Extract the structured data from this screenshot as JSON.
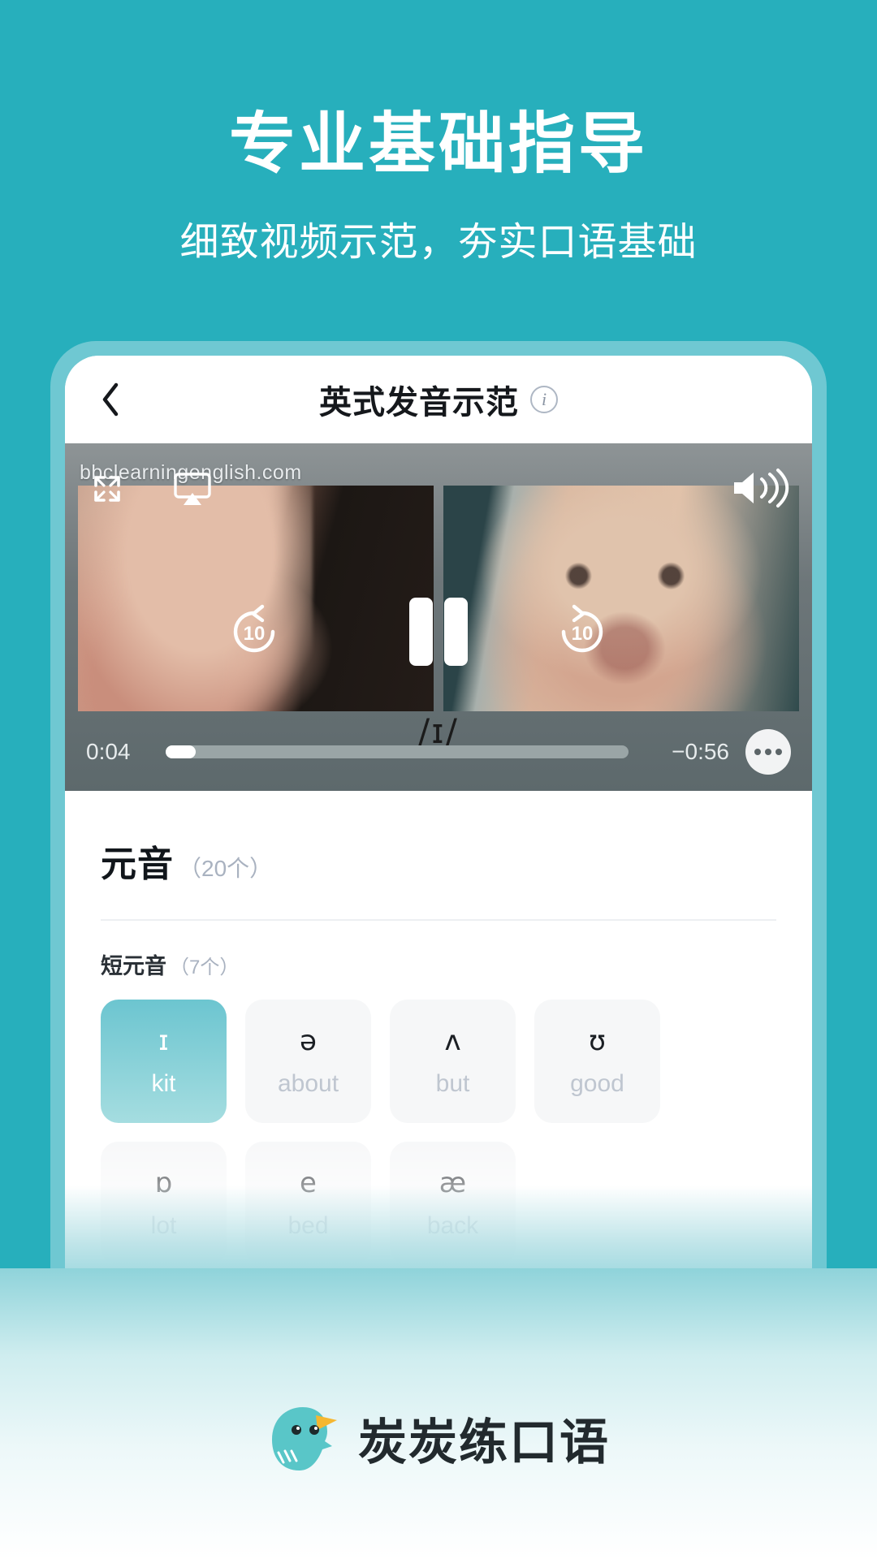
{
  "hero": {
    "title": "专业基础指导",
    "subtitle": "细致视频示范，夯实口语基础"
  },
  "phone": {
    "navbar": {
      "back_icon": "chevron-left-icon",
      "title": "英式发音示范",
      "info_icon": "info-circle-icon",
      "info_label": "i"
    },
    "video": {
      "watermark": "bbclearningenglish.com",
      "expand_icon": "expand-fullscreen-icon",
      "airplay_icon": "airplay-icon",
      "volume_icon": "volume-high-icon",
      "rewind_label": "10",
      "forward_label": "10",
      "pause_icon": "pause-icon",
      "ipa_label": "/ɪ/",
      "current_time": "0:04",
      "remaining_time": "−0:56",
      "progress_percent": 6.5,
      "more_icon": "more-ellipsis-icon"
    },
    "content": {
      "section": {
        "title": "元音",
        "count": "（20个）"
      },
      "subsection": {
        "title": "短元音",
        "count": "（7个）"
      },
      "tiles": [
        {
          "symbol": "ɪ",
          "word": "kit",
          "selected": true
        },
        {
          "symbol": "ə",
          "word": "about",
          "selected": false
        },
        {
          "symbol": "ʌ",
          "word": "but",
          "selected": false
        },
        {
          "symbol": "ʊ",
          "word": "good",
          "selected": false
        },
        {
          "symbol": "ɒ",
          "word": "lot",
          "selected": false
        },
        {
          "symbol": "e",
          "word": "bed",
          "selected": false
        },
        {
          "symbol": "æ",
          "word": "back",
          "selected": false
        }
      ]
    }
  },
  "footer": {
    "logo_icon": "bird-mascot-logo",
    "brand_name": "炭炭练口语"
  },
  "colors": {
    "teal_bg": "#27AFBC",
    "phone_border": "#6FC8D2",
    "tile_active_top": "#6CC5D0",
    "tile_active_bottom": "#A5DDE0",
    "tile_idle": "#F6F7F8",
    "muted_text": "#A9B2C0"
  }
}
